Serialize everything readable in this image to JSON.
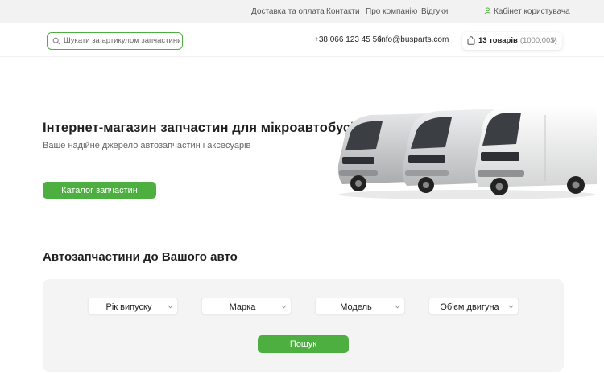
{
  "topbar": {
    "nav": [
      {
        "label": "Доставка та оплата"
      },
      {
        "label": "Контакти"
      },
      {
        "label": "Про компанію"
      },
      {
        "label": "Відгуки"
      }
    ],
    "cabinet_label": "Кабінет користувача"
  },
  "header": {
    "search": {
      "placeholder": "Шукати за артикулом запчастини",
      "value": ""
    },
    "phone": "+38 066 123 45 56",
    "email": "info@busparts.com",
    "cart": {
      "count_label": "13 товарів",
      "total": "(1000,00$)"
    }
  },
  "hero": {
    "title": "Інтернет-магазин запчастин для мікроавтобусів",
    "subtitle": "Ваше надійне джерело автозапчастин і аксесуарів",
    "catalog_button": "Каталог запчастин"
  },
  "picker": {
    "title": "Автозапчастини до Вашого авто",
    "selects": [
      {
        "label": "Рік випуску"
      },
      {
        "label": "Марка"
      },
      {
        "label": "Модель"
      },
      {
        "label": "Об'єм двигуна"
      }
    ],
    "search_button": "Пошук"
  },
  "colors": {
    "accent": "#4caf3f",
    "topbar": "#f2f2f2",
    "picker_bg": "#f4f4f4"
  },
  "icons": {
    "search": "search-icon",
    "user": "user-icon",
    "cart": "shopping-bag-icon",
    "dropdown": "chevron-down-icon"
  }
}
